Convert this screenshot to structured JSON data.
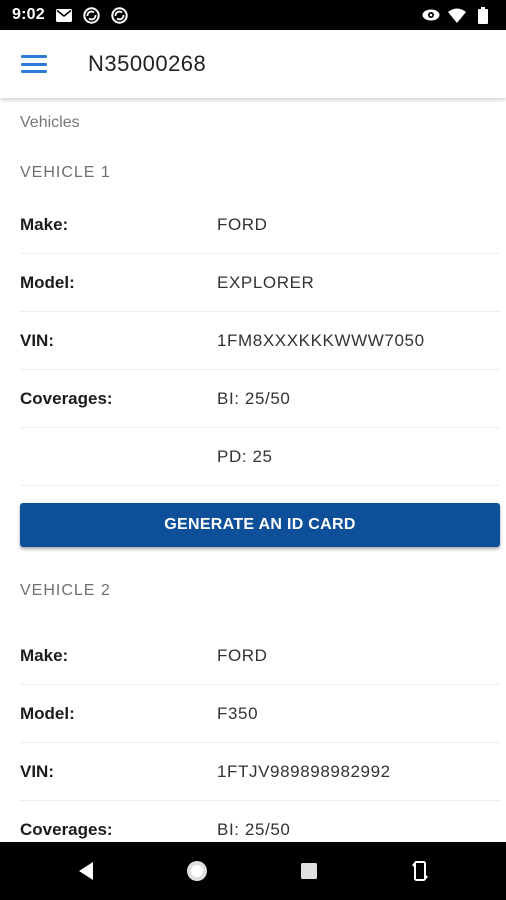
{
  "status_bar": {
    "time": "9:02",
    "icons_left": [
      "mail-icon",
      "sync-icon",
      "sync-icon"
    ],
    "icons_right": [
      "eye-icon",
      "wifi-icon",
      "battery-icon"
    ]
  },
  "app_bar": {
    "title": "N35000268",
    "menu_icon": "menu-icon",
    "accent_color": "#2e7bd6"
  },
  "section_label": "Vehicles",
  "vehicles": [
    {
      "header": "VEHICLE 1",
      "make_label": "Make:",
      "make": "FORD",
      "model_label": "Model:",
      "model": "EXPLORER",
      "vin_label": "VIN:",
      "vin": "1FM8XXXKKKWWW7050",
      "coverages_label": "Coverages:",
      "coverages": [
        "BI: 25/50",
        "PD: 25"
      ],
      "button_label": "GENERATE AN ID CARD"
    },
    {
      "header": "VEHICLE 2",
      "make_label": "Make:",
      "make": "FORD",
      "model_label": "Model:",
      "model": "F350",
      "vin_label": "VIN:",
      "vin": "1FTJV989898982992",
      "coverages_label": "Coverages:",
      "coverages": [
        "BI: 25/50"
      ]
    }
  ],
  "button_color": "#0d4f99",
  "nav_bar": {
    "icons": [
      "back-icon",
      "home-icon",
      "recents-icon",
      "rotate-icon"
    ]
  }
}
